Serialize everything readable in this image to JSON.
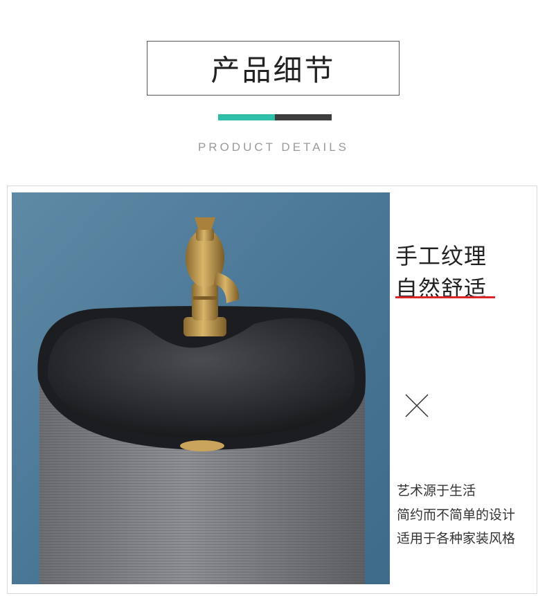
{
  "header": {
    "title": "产品细节",
    "subtitle": "PRODUCT DETAILS",
    "colors": {
      "teal": "#2fbfa8",
      "dark": "#3d3d3d"
    }
  },
  "feature": {
    "headline_line1": "手工纹理",
    "headline_line2": "自然舒适",
    "accent_color": "#d8262a",
    "divider_icon": "x-icon",
    "description": [
      "艺术源于生活",
      "简约而不简单的设计",
      "适用于各种家装风格"
    ]
  }
}
